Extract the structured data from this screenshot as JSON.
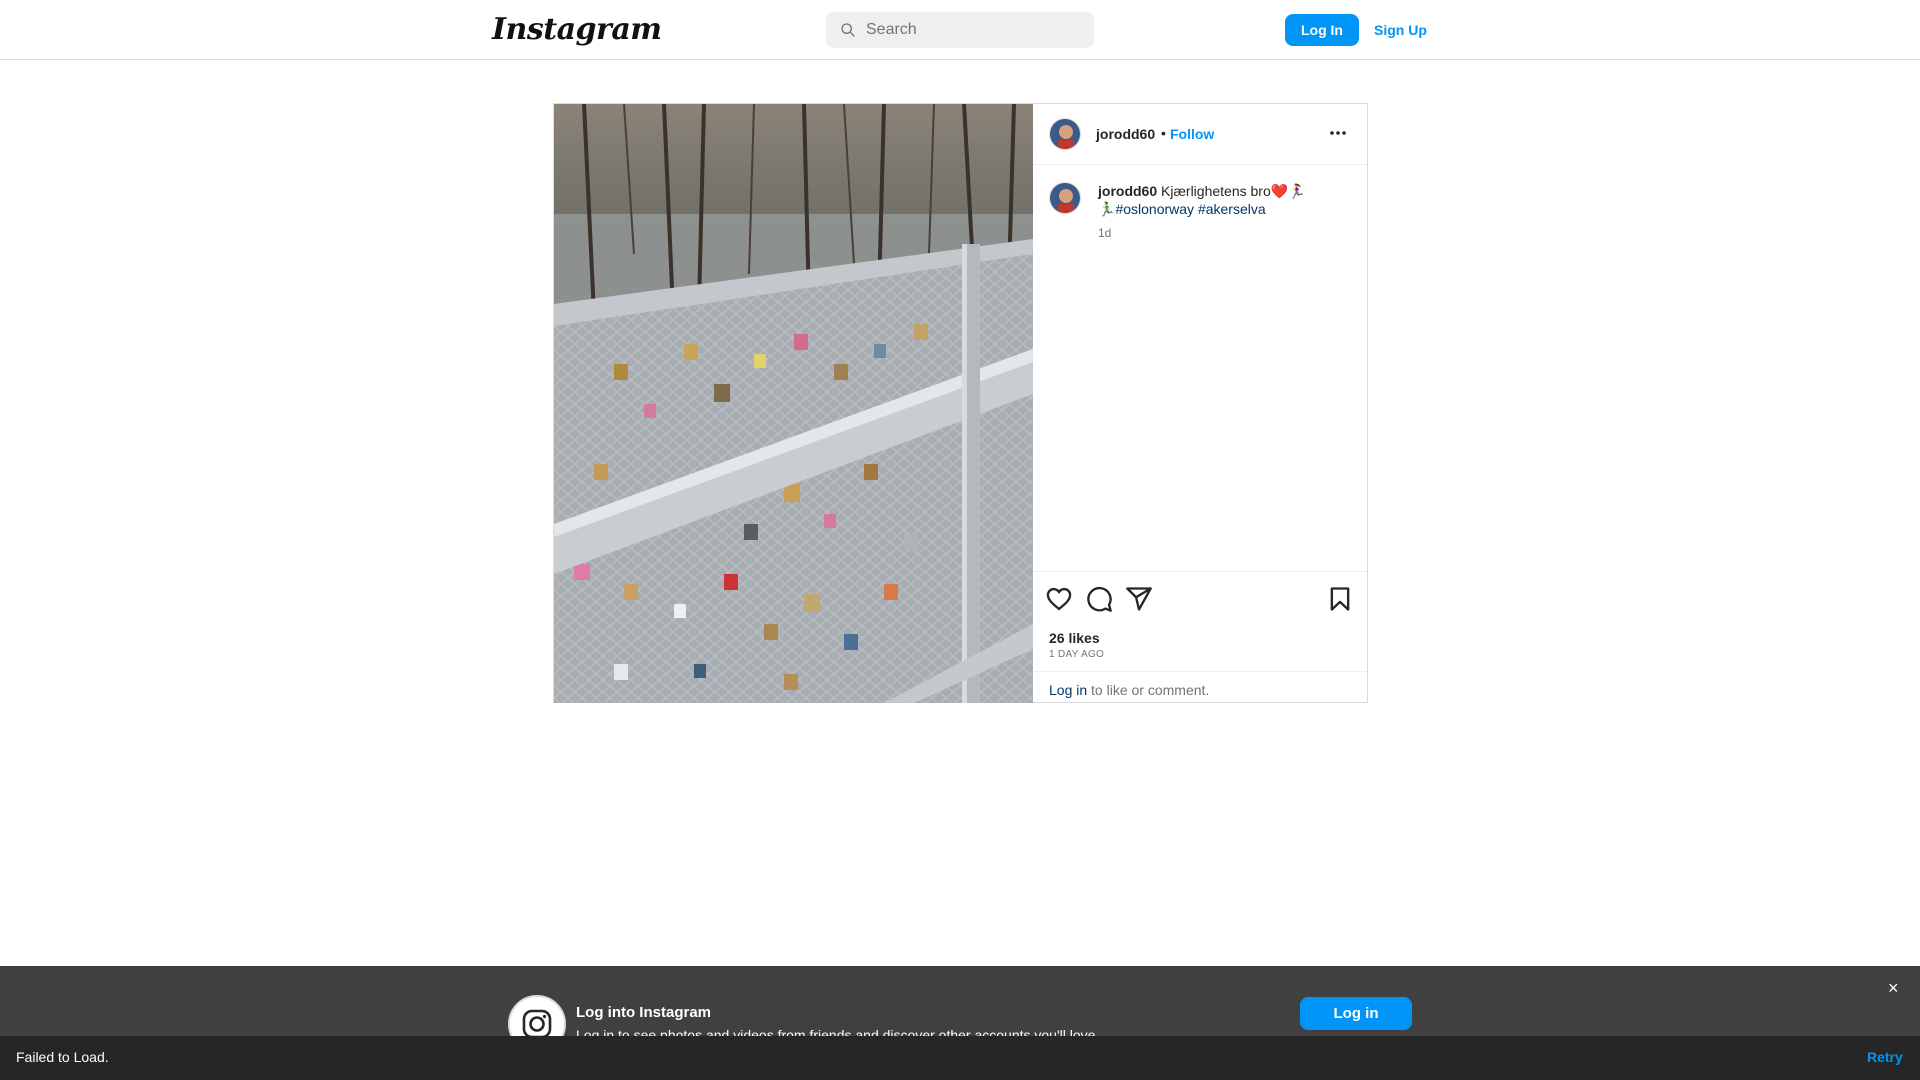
{
  "nav": {
    "logo": "Instagram",
    "search_placeholder": "Search",
    "login_label": "Log In",
    "signup_label": "Sign Up"
  },
  "post": {
    "username": "jorodd60",
    "separator": "•",
    "follow_label": "Follow",
    "caption_user": "jorodd60",
    "caption_text": "Kjærlighetens bro❤️🏃‍♀️🏃‍♂️",
    "hashtags": [
      "#oslonorway",
      "#akerselva"
    ],
    "time_short": "1d",
    "likes": "26 likes",
    "time_long": "1 DAY AGO",
    "login_link": "Log in",
    "login_suffix": " to like or comment."
  },
  "banner": {
    "title": "Log into Instagram",
    "subtitle": "Log in to see photos and videos from friends and discover other accounts you'll love.",
    "button_label": "Log in",
    "close_glyph": "×"
  },
  "toast": {
    "message": "Failed to Load.",
    "retry_label": "Retry"
  },
  "colors": {
    "accent": "#0095f6",
    "hashtag": "#00376b",
    "muted": "#737373",
    "banner_bg": "#404040",
    "toast_bg": "#262626"
  },
  "icons": [
    "search-icon",
    "more-icon",
    "heart-icon",
    "comment-icon",
    "share-icon",
    "bookmark-icon",
    "instagram-icon",
    "close-icon"
  ]
}
